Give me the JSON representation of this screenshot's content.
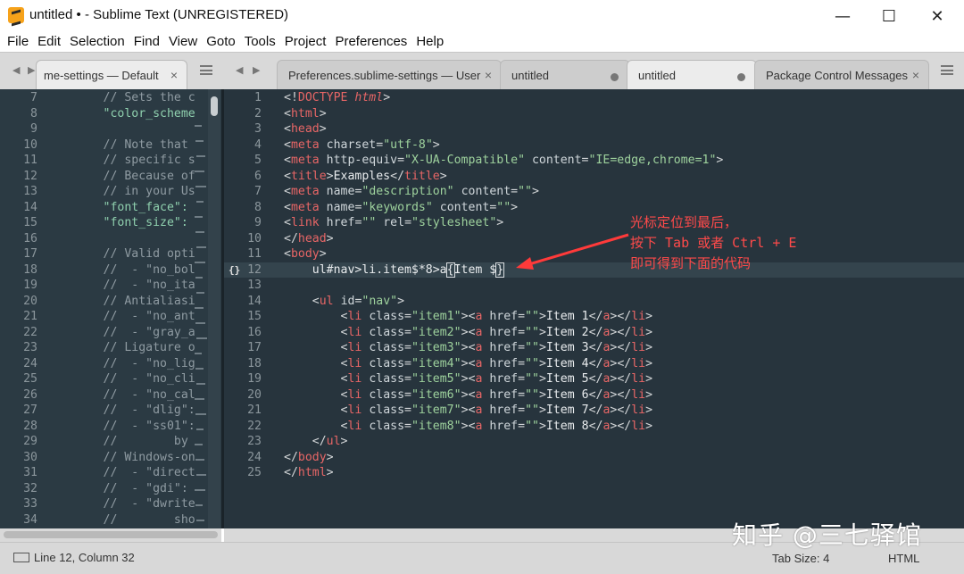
{
  "window": {
    "title": "untitled • - Sublime Text (UNREGISTERED)",
    "minimize": "—",
    "maximize": "☐",
    "close": "✕"
  },
  "menu": [
    "File",
    "Edit",
    "Selection",
    "Find",
    "View",
    "Goto",
    "Tools",
    "Project",
    "Preferences",
    "Help"
  ],
  "tabs": {
    "left": {
      "label": "me-settings — Default"
    },
    "right": [
      {
        "label": "Preferences.sublime-settings — User",
        "close": "×"
      },
      {
        "label": "untitled",
        "dirty": true
      },
      {
        "label": "untitled",
        "dirty": true,
        "active": true
      },
      {
        "label": "Package Control Messages",
        "close": "×"
      }
    ]
  },
  "left_editor": {
    "lines": [
      {
        "n": "7",
        "text": "        // Sets the c"
      },
      {
        "n": "8",
        "text": "        \"color_scheme"
      },
      {
        "n": "9",
        "text": ""
      },
      {
        "n": "10",
        "text": "        // Note that"
      },
      {
        "n": "11",
        "text": "        // specific s"
      },
      {
        "n": "12",
        "text": "        // Because of"
      },
      {
        "n": "13",
        "text": "        // in your Us"
      },
      {
        "n": "14",
        "text": "        \"font_face\":"
      },
      {
        "n": "15",
        "text": "        \"font_size\":"
      },
      {
        "n": "16",
        "text": ""
      },
      {
        "n": "17",
        "text": "        // Valid opti"
      },
      {
        "n": "18",
        "text": "        //  - \"no_bol"
      },
      {
        "n": "19",
        "text": "        //  - \"no_ita"
      },
      {
        "n": "20",
        "text": "        // Antialiasi"
      },
      {
        "n": "21",
        "text": "        //  - \"no_ant"
      },
      {
        "n": "22",
        "text": "        //  - \"gray_a"
      },
      {
        "n": "23",
        "text": "        // Ligature o"
      },
      {
        "n": "24",
        "text": "        //  - \"no_lig"
      },
      {
        "n": "25",
        "text": "        //  - \"no_cli"
      },
      {
        "n": "26",
        "text": "        //  - \"no_cal"
      },
      {
        "n": "27",
        "text": "        //  - \"dlig\":"
      },
      {
        "n": "28",
        "text": "        //  - \"ss01\":"
      },
      {
        "n": "29",
        "text": "        //        by"
      },
      {
        "n": "30",
        "text": "        // Windows-on"
      },
      {
        "n": "31",
        "text": "        //  - \"direct"
      },
      {
        "n": "32",
        "text": "        //  - \"gdi\":"
      },
      {
        "n": "33",
        "text": "        //  - \"dwrite"
      },
      {
        "n": "34",
        "text": "        //        sho"
      }
    ]
  },
  "right_editor": {
    "current_line": 12,
    "gutter_mark": "{}",
    "lines": [
      {
        "n": "1",
        "html": "<span class='punc'>&lt;!</span><span class='tag'>DOCTYPE</span> <span class='kw'>html</span><span class='punc'>&gt;</span>"
      },
      {
        "n": "2",
        "html": "<span class='punc'>&lt;</span><span class='tag'>html</span><span class='punc'>&gt;</span>"
      },
      {
        "n": "3",
        "html": "<span class='punc'>&lt;</span><span class='tag'>head</span><span class='punc'>&gt;</span>"
      },
      {
        "n": "4",
        "html": "<span class='punc'>&lt;</span><span class='tag'>meta</span> <span class='attr'>charset</span><span class='punc'>=</span><span class='val'>\"utf-8\"</span><span class='punc'>&gt;</span>"
      },
      {
        "n": "5",
        "html": "<span class='punc'>&lt;</span><span class='tag'>meta</span> <span class='attr'>http-equiv</span><span class='punc'>=</span><span class='val'>\"X-UA-Compatible\"</span> <span class='attr'>content</span><span class='punc'>=</span><span class='val'>\"IE=edge,chrome=1\"</span><span class='punc'>&gt;</span>"
      },
      {
        "n": "6",
        "html": "<span class='punc'>&lt;</span><span class='tag'>title</span><span class='punc'>&gt;</span><span class='txt'>Examples</span><span class='punc'>&lt;/</span><span class='tag'>title</span><span class='punc'>&gt;</span>"
      },
      {
        "n": "7",
        "html": "<span class='punc'>&lt;</span><span class='tag'>meta</span> <span class='attr'>name</span><span class='punc'>=</span><span class='val'>\"description\"</span> <span class='attr'>content</span><span class='punc'>=</span><span class='val'>\"\"</span><span class='punc'>&gt;</span>"
      },
      {
        "n": "8",
        "html": "<span class='punc'>&lt;</span><span class='tag'>meta</span> <span class='attr'>name</span><span class='punc'>=</span><span class='val'>\"keywords\"</span> <span class='attr'>content</span><span class='punc'>=</span><span class='val'>\"\"</span><span class='punc'>&gt;</span>"
      },
      {
        "n": "9",
        "html": "<span class='punc'>&lt;</span><span class='tag'>link</span> <span class='attr'>href</span><span class='punc'>=</span><span class='val'>\"\"</span> <span class='attr'>rel</span><span class='punc'>=</span><span class='val'>\"stylesheet\"</span><span class='punc'>&gt;</span>"
      },
      {
        "n": "10",
        "html": "<span class='punc'>&lt;/</span><span class='tag'>head</span><span class='punc'>&gt;</span>"
      },
      {
        "n": "11",
        "html": "<span class='punc'>&lt;</span><span class='tag'>body</span><span class='punc'>&gt;</span>"
      },
      {
        "n": "12",
        "html": "    <span class='txt'>ul#nav&gt;li.item$*8&gt;a</span><span class='txt cursor-box'>{</span><span class='txt'>Item $</span><span class='txt cursor-box'>}</span>"
      },
      {
        "n": "13",
        "html": ""
      },
      {
        "n": "14",
        "html": "    <span class='punc'>&lt;</span><span class='tag'>ul</span> <span class='attr'>id</span><span class='punc'>=</span><span class='val'>\"nav\"</span><span class='punc'>&gt;</span>"
      },
      {
        "n": "15",
        "html": "        <span class='punc'>&lt;</span><span class='tag'>li</span> <span class='attr'>class</span><span class='punc'>=</span><span class='val'>\"item1\"</span><span class='punc'>&gt;&lt;</span><span class='tag'>a</span> <span class='attr'>href</span><span class='punc'>=</span><span class='val'>\"\"</span><span class='punc'>&gt;</span><span class='txt'>Item 1</span><span class='punc'>&lt;/</span><span class='tag'>a</span><span class='punc'>&gt;&lt;/</span><span class='tag'>li</span><span class='punc'>&gt;</span>"
      },
      {
        "n": "16",
        "html": "        <span class='punc'>&lt;</span><span class='tag'>li</span> <span class='attr'>class</span><span class='punc'>=</span><span class='val'>\"item2\"</span><span class='punc'>&gt;&lt;</span><span class='tag'>a</span> <span class='attr'>href</span><span class='punc'>=</span><span class='val'>\"\"</span><span class='punc'>&gt;</span><span class='txt'>Item 2</span><span class='punc'>&lt;/</span><span class='tag'>a</span><span class='punc'>&gt;&lt;/</span><span class='tag'>li</span><span class='punc'>&gt;</span>"
      },
      {
        "n": "17",
        "html": "        <span class='punc'>&lt;</span><span class='tag'>li</span> <span class='attr'>class</span><span class='punc'>=</span><span class='val'>\"item3\"</span><span class='punc'>&gt;&lt;</span><span class='tag'>a</span> <span class='attr'>href</span><span class='punc'>=</span><span class='val'>\"\"</span><span class='punc'>&gt;</span><span class='txt'>Item 3</span><span class='punc'>&lt;/</span><span class='tag'>a</span><span class='punc'>&gt;&lt;/</span><span class='tag'>li</span><span class='punc'>&gt;</span>"
      },
      {
        "n": "18",
        "html": "        <span class='punc'>&lt;</span><span class='tag'>li</span> <span class='attr'>class</span><span class='punc'>=</span><span class='val'>\"item4\"</span><span class='punc'>&gt;&lt;</span><span class='tag'>a</span> <span class='attr'>href</span><span class='punc'>=</span><span class='val'>\"\"</span><span class='punc'>&gt;</span><span class='txt'>Item 4</span><span class='punc'>&lt;/</span><span class='tag'>a</span><span class='punc'>&gt;&lt;/</span><span class='tag'>li</span><span class='punc'>&gt;</span>"
      },
      {
        "n": "19",
        "html": "        <span class='punc'>&lt;</span><span class='tag'>li</span> <span class='attr'>class</span><span class='punc'>=</span><span class='val'>\"item5\"</span><span class='punc'>&gt;&lt;</span><span class='tag'>a</span> <span class='attr'>href</span><span class='punc'>=</span><span class='val'>\"\"</span><span class='punc'>&gt;</span><span class='txt'>Item 5</span><span class='punc'>&lt;/</span><span class='tag'>a</span><span class='punc'>&gt;&lt;/</span><span class='tag'>li</span><span class='punc'>&gt;</span>"
      },
      {
        "n": "20",
        "html": "        <span class='punc'>&lt;</span><span class='tag'>li</span> <span class='attr'>class</span><span class='punc'>=</span><span class='val'>\"item6\"</span><span class='punc'>&gt;&lt;</span><span class='tag'>a</span> <span class='attr'>href</span><span class='punc'>=</span><span class='val'>\"\"</span><span class='punc'>&gt;</span><span class='txt'>Item 6</span><span class='punc'>&lt;/</span><span class='tag'>a</span><span class='punc'>&gt;&lt;/</span><span class='tag'>li</span><span class='punc'>&gt;</span>"
      },
      {
        "n": "21",
        "html": "        <span class='punc'>&lt;</span><span class='tag'>li</span> <span class='attr'>class</span><span class='punc'>=</span><span class='val'>\"item7\"</span><span class='punc'>&gt;&lt;</span><span class='tag'>a</span> <span class='attr'>href</span><span class='punc'>=</span><span class='val'>\"\"</span><span class='punc'>&gt;</span><span class='txt'>Item 7</span><span class='punc'>&lt;/</span><span class='tag'>a</span><span class='punc'>&gt;&lt;/</span><span class='tag'>li</span><span class='punc'>&gt;</span>"
      },
      {
        "n": "22",
        "html": "        <span class='punc'>&lt;</span><span class='tag'>li</span> <span class='attr'>class</span><span class='punc'>=</span><span class='val'>\"item8\"</span><span class='punc'>&gt;&lt;</span><span class='tag'>a</span> <span class='attr'>href</span><span class='punc'>=</span><span class='val'>\"\"</span><span class='punc'>&gt;</span><span class='txt'>Item 8</span><span class='punc'>&lt;/</span><span class='tag'>a</span><span class='punc'>&gt;&lt;/</span><span class='tag'>li</span><span class='punc'>&gt;</span>"
      },
      {
        "n": "23",
        "html": "    <span class='punc'>&lt;/</span><span class='tag'>ul</span><span class='punc'>&gt;</span>"
      },
      {
        "n": "24",
        "html": "<span class='punc'>&lt;/</span><span class='tag'>body</span><span class='punc'>&gt;</span>"
      },
      {
        "n": "25",
        "html": "<span class='punc'>&lt;/</span><span class='tag'>html</span><span class='punc'>&gt;</span>"
      }
    ]
  },
  "annotation": {
    "lines": [
      "光标定位到最后，",
      "按下 Tab 或者 Ctrl + E",
      "即可得到下面的代码"
    ],
    "color": "#ff4a4a"
  },
  "watermark": "知乎 @三七驿馆",
  "status": {
    "position": "Line 12, Column 32",
    "tab_size": "Tab Size: 4",
    "syntax": "HTML"
  },
  "colors": {
    "editor_bg": "#27343d",
    "tag": "#e86666",
    "string": "#9ed29d",
    "annotation": "#ff4a4a"
  }
}
